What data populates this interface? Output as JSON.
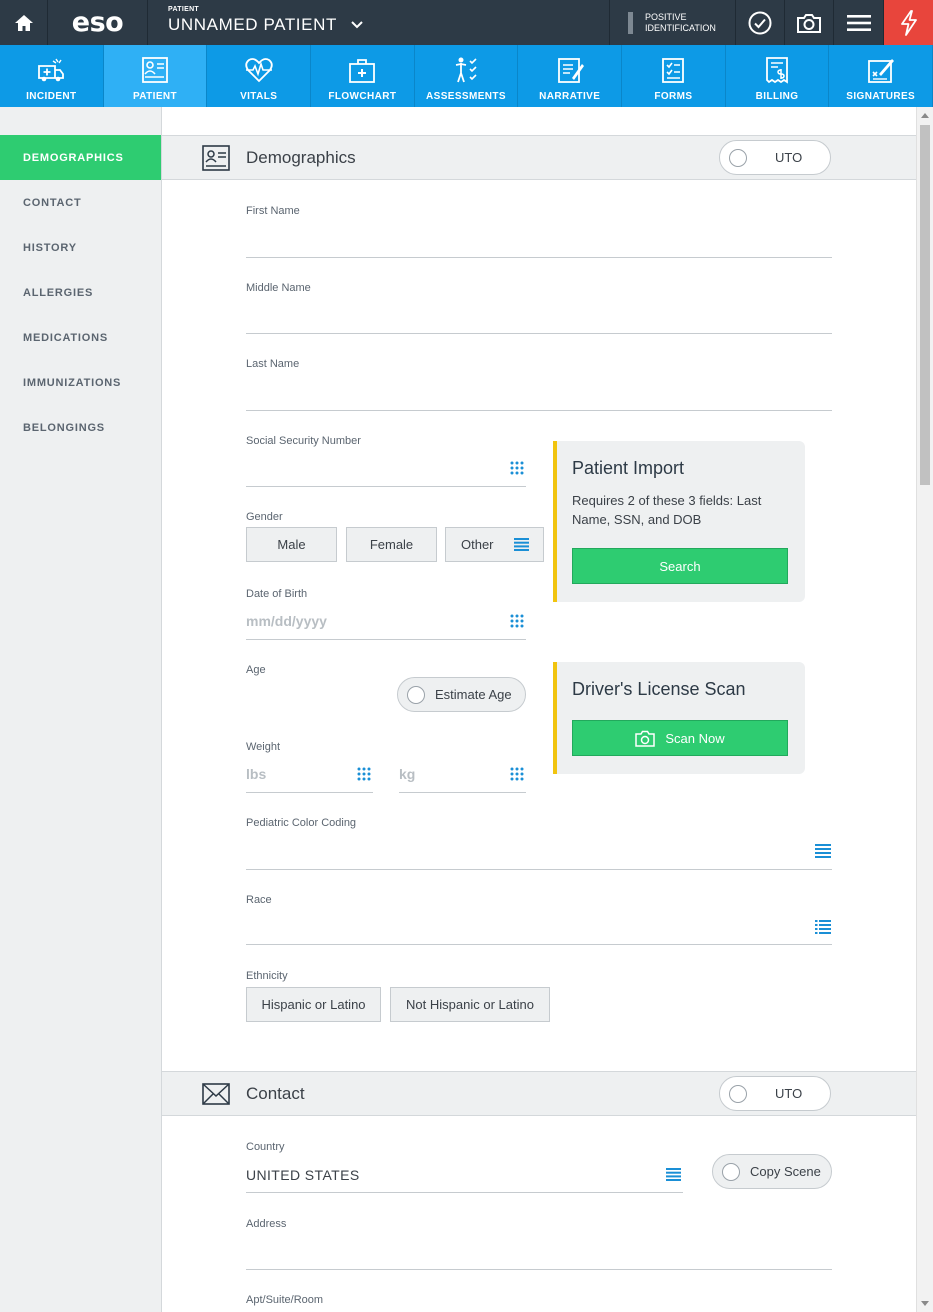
{
  "topbar": {
    "logo": "eso",
    "patient_caption": "PATIENT",
    "patient_name": "UNNAMED PATIENT",
    "positive_id_line1": "POSITIVE",
    "positive_id_line2": "IDENTIFICATION",
    "icons": [
      "home-icon",
      "chevron-down-icon",
      "checkmark-icon",
      "camera-icon",
      "hamburger-menu-icon",
      "flash-icon"
    ],
    "alert_color": "#e8453c"
  },
  "tabs": [
    {
      "label": "INCIDENT",
      "icon": "ambulance-icon"
    },
    {
      "label": "PATIENT",
      "icon": "patient-card-icon",
      "active": true
    },
    {
      "label": "VITALS",
      "icon": "heart-pulse-icon"
    },
    {
      "label": "FLOWCHART",
      "icon": "medical-kit-icon"
    },
    {
      "label": "ASSESSMENTS",
      "icon": "body-checklist-icon"
    },
    {
      "label": "NARRATIVE",
      "icon": "notepad-icon"
    },
    {
      "label": "FORMS",
      "icon": "checklist-icon"
    },
    {
      "label": "BILLING",
      "icon": "invoice-icon"
    },
    {
      "label": "SIGNATURES",
      "icon": "signature-icon"
    }
  ],
  "sidenav": [
    {
      "label": "DEMOGRAPHICS",
      "active": true
    },
    {
      "label": "CONTACT"
    },
    {
      "label": "HISTORY"
    },
    {
      "label": "ALLERGIES"
    },
    {
      "label": "MEDICATIONS"
    },
    {
      "label": "IMMUNIZATIONS"
    },
    {
      "label": "BELONGINGS"
    }
  ],
  "demographics": {
    "title": "Demographics",
    "uto_label": "UTO",
    "first_name_label": "First Name",
    "middle_name_label": "Middle Name",
    "last_name_label": "Last Name",
    "ssn_label": "Social Security Number",
    "gender_label": "Gender",
    "gender_options": [
      "Male",
      "Female",
      "Other"
    ],
    "dob_label": "Date of Birth",
    "dob_placeholder": "mm/dd/yyyy",
    "age_label": "Age",
    "estimate_age_label": "Estimate Age",
    "weight_label": "Weight",
    "weight_lbs_placeholder": "lbs",
    "weight_kg_placeholder": "kg",
    "pediatric_label": "Pediatric Color Coding",
    "race_label": "Race",
    "ethnicity_label": "Ethnicity",
    "ethnicity_options": [
      "Hispanic or Latino",
      "Not Hispanic or Latino"
    ]
  },
  "patient_import": {
    "title": "Patient Import",
    "description": "Requires 2 of these 3 fields: Last Name, SSN, and DOB",
    "button": "Search"
  },
  "license_scan": {
    "title": "Driver's License Scan",
    "button": "Scan Now"
  },
  "contact": {
    "title": "Contact",
    "uto_label": "UTO",
    "country_label": "Country",
    "country_value": "UNITED STATES",
    "copy_scene_label": "Copy Scene",
    "address_label": "Address",
    "apt_label": "Apt/Suite/Room"
  },
  "colors": {
    "nav_dark": "#2d3a46",
    "tab_blue": "#0d9ae6",
    "active_green": "#2ecc71",
    "card_accent": "#f1c40f"
  }
}
